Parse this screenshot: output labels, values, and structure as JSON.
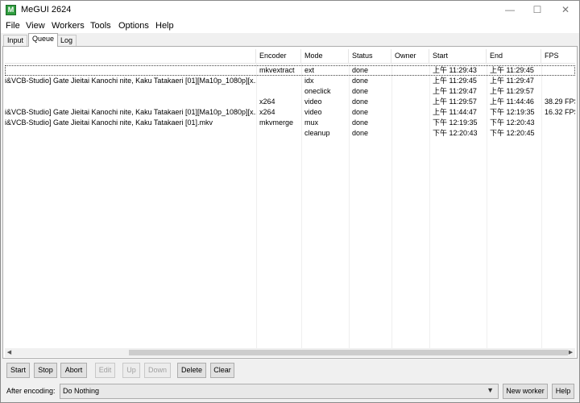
{
  "window": {
    "title": "MeGUI 2624",
    "icon_letter": "M",
    "controls": {
      "minimize": "—",
      "maximize": "☐",
      "close": "✕"
    }
  },
  "menu": [
    "File",
    "View",
    "Workers",
    "Tools",
    "Options",
    "Help"
  ],
  "tabs": [
    "Input",
    "Queue",
    "Log"
  ],
  "active_tab": "Queue",
  "columns": [
    "",
    "Encoder",
    "Mode",
    "Status",
    "Owner",
    "Start",
    "End",
    "FPS"
  ],
  "rows": [
    {
      "job": "",
      "encoder": "mkvextract",
      "mode": "ext",
      "status": "done",
      "owner": "",
      "start": "上午 11:29:43",
      "end": "上午 11:29:45",
      "fps": ""
    },
    {
      "job": "i&VCB-Studio] Gate Jieitai Kanochi nite, Kaku Tatakaeri [01][Ma10p_1080p][x...",
      "encoder": "",
      "mode": "idx",
      "status": "done",
      "owner": "",
      "start": "上午 11:29:45",
      "end": "上午 11:29:47",
      "fps": ""
    },
    {
      "job": "",
      "encoder": "",
      "mode": "oneclick",
      "status": "done",
      "owner": "",
      "start": "上午 11:29:47",
      "end": "上午 11:29:57",
      "fps": ""
    },
    {
      "job": "",
      "encoder": "x264",
      "mode": "video",
      "status": "done",
      "owner": "",
      "start": "上午 11:29:57",
      "end": "上午 11:44:46",
      "fps": "38.29 FPS"
    },
    {
      "job": "i&VCB-Studio] Gate Jieitai Kanochi nite, Kaku Tatakaeri [01][Ma10p_1080p][x...",
      "encoder": "x264",
      "mode": "video",
      "status": "done",
      "owner": "",
      "start": "上午 11:44:47",
      "end": "下午 12:19:35",
      "fps": "16.32 FPS"
    },
    {
      "job": "i&VCB-Studio] Gate Jieitai Kanochi nite, Kaku Tatakaeri [01].mkv",
      "encoder": "mkvmerge",
      "mode": "mux",
      "status": "done",
      "owner": "",
      "start": "下午 12:19:35",
      "end": "下午 12:20:43",
      "fps": ""
    },
    {
      "job": "",
      "encoder": "",
      "mode": "cleanup",
      "status": "done",
      "owner": "",
      "start": "下午 12:20:43",
      "end": "下午 12:20:45",
      "fps": ""
    }
  ],
  "buttons": [
    {
      "label": "Start",
      "enabled": true
    },
    {
      "label": "Stop",
      "enabled": true
    },
    {
      "label": "Abort",
      "enabled": true
    },
    {
      "label": "Edit",
      "enabled": false
    },
    {
      "label": "Up",
      "enabled": false
    },
    {
      "label": "Down",
      "enabled": false
    },
    {
      "label": "Delete",
      "enabled": true
    },
    {
      "label": "Clear",
      "enabled": true
    }
  ],
  "after_encoding": {
    "label": "After encoding:",
    "value": "Do Nothing"
  },
  "new_worker_label": "New worker",
  "help_label": "Help",
  "scroll": {
    "left": "◀",
    "right": "▶"
  }
}
